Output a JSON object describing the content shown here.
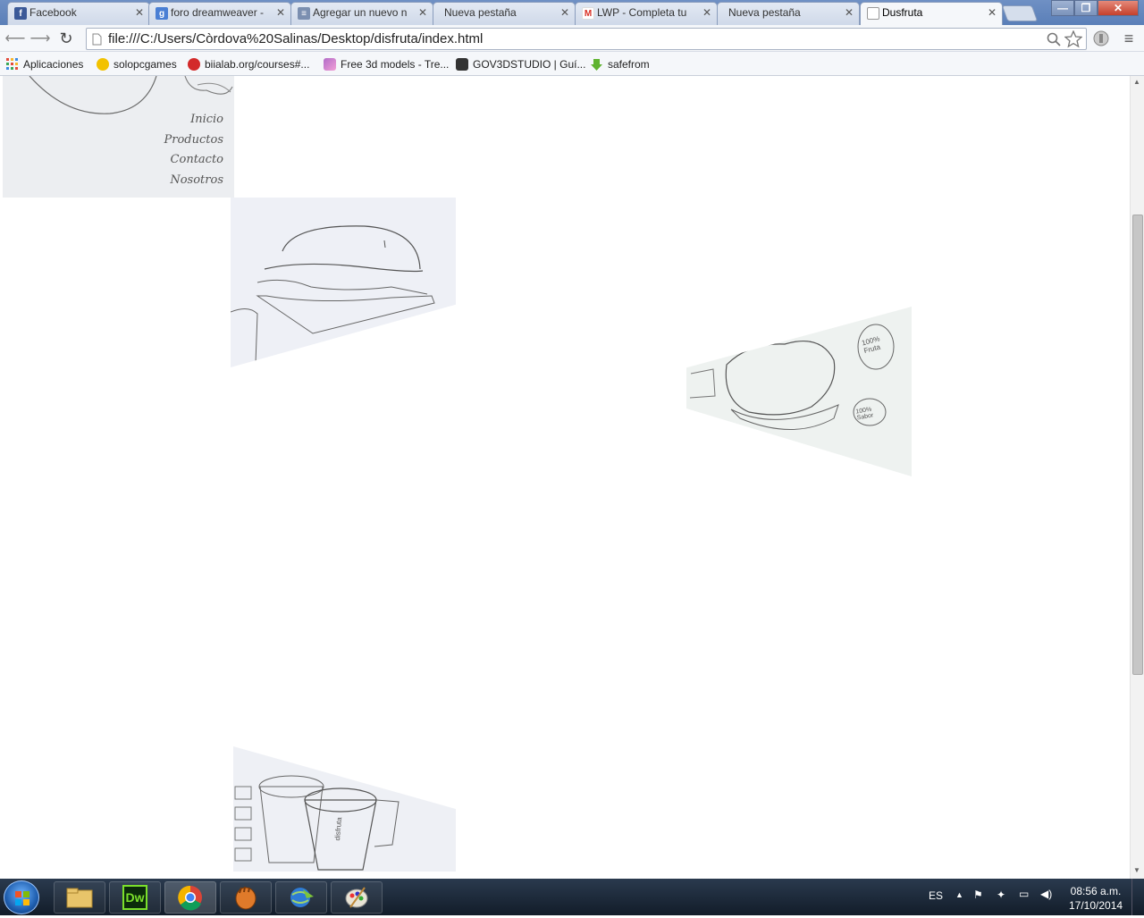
{
  "tabs": [
    {
      "label": "Facebook",
      "icon": "facebook-icon",
      "color": "#3b5998",
      "glyph": "f"
    },
    {
      "label": "foro dreamweaver -",
      "icon": "google-icon",
      "color": "#4a7fd4",
      "glyph": "g"
    },
    {
      "label": "Agregar un nuevo n",
      "icon": "page-icon",
      "color": "#7b8fb0",
      "glyph": "≡"
    },
    {
      "label": "Nueva pestaña",
      "icon": "",
      "color": "",
      "glyph": ""
    },
    {
      "label": "LWP - Completa tu",
      "icon": "gmail-icon",
      "color": "#d93025",
      "glyph": "M"
    },
    {
      "label": "Nueva pestaña",
      "icon": "",
      "color": "",
      "glyph": ""
    },
    {
      "label": "Dusfruta",
      "icon": "document-icon",
      "color": "#ffffff",
      "glyph": ""
    }
  ],
  "omnibox": {
    "url": "file:///C:/Users/Còrdova%20Salinas/Desktop/disfruta/index.html"
  },
  "bookmarks": [
    {
      "label": "Aplicaciones",
      "icon": "apps-grid-icon",
      "color": "#e34b3c"
    },
    {
      "label": "solopcgames",
      "icon": "pacman-icon",
      "color": "#f2c200"
    },
    {
      "label": "biialab.org/courses#...",
      "icon": "biialab-icon",
      "color": "#d32a2a"
    },
    {
      "label": "Free 3d models - Tre...",
      "icon": "flag-icon",
      "color": "#b16cc8"
    },
    {
      "label": "GOV3DSTUDIO | Guí...",
      "icon": "mask-icon",
      "color": "#333333"
    },
    {
      "label": "safefrom",
      "icon": "download-arrow-icon",
      "color": "#5fb32f"
    }
  ],
  "page": {
    "menu": [
      "Inicio",
      "Productos",
      "Contacto",
      "Nosotros"
    ],
    "sketch_labels": {
      "icecream_1": "100% Fruta",
      "icecream_2": "100% Sabor",
      "cup_label": "disfruta"
    }
  },
  "taskbar": {
    "apps": [
      {
        "name": "explorer",
        "icon": "folder-icon",
        "label": ""
      },
      {
        "name": "dreamweaver",
        "icon": "dreamweaver-icon",
        "label": "Dw"
      },
      {
        "name": "chrome",
        "icon": "chrome-icon",
        "label": ""
      },
      {
        "name": "game",
        "icon": "glove-icon",
        "label": ""
      },
      {
        "name": "download-manager",
        "icon": "globe-arrow-icon",
        "label": ""
      },
      {
        "name": "paint",
        "icon": "palette-icon",
        "label": ""
      }
    ],
    "language": "ES",
    "time": "08:56 a.m.",
    "date": "17/10/2014"
  },
  "colors": {
    "tab_strip": "#5a7fb8",
    "toolbar": "#f5f7fa",
    "taskbar": "#1a2636"
  }
}
